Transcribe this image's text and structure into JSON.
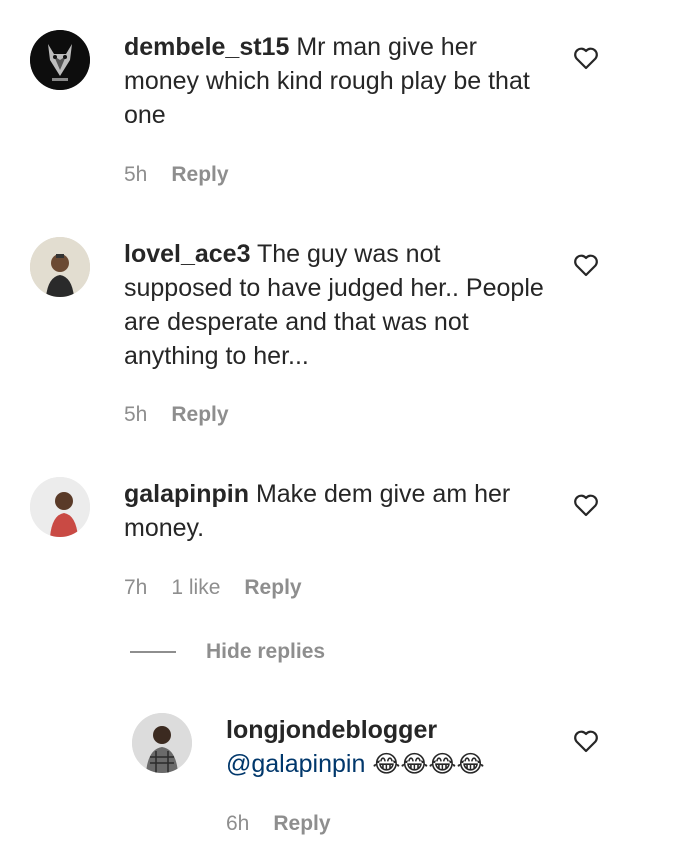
{
  "comments": [
    {
      "username": "dembele_st15",
      "text": " Mr man give her money which kind rough play be that one",
      "time": "5h",
      "reply_label": "Reply",
      "avatar": "wolf-avatar"
    },
    {
      "username": "lovel_ace3",
      "text": " The guy was not supposed to have judged her.. People are desperate and that was not anything to her...",
      "time": "5h",
      "reply_label": "Reply",
      "avatar": "person-avatar"
    },
    {
      "username": "galapinpin",
      "text": " Make dem give am her money.",
      "time": "7h",
      "likes": "1 like",
      "reply_label": "Reply",
      "avatar": "person-avatar"
    }
  ],
  "hide_replies_label": "Hide replies",
  "reply": {
    "username": "longjondeblogger",
    "mention": "@galapinpin",
    "emojis": "😂😂😂😂",
    "time": "6h",
    "reply_label": "Reply",
    "avatar": "person-avatar"
  },
  "icons": {
    "like": "heart-outline-icon"
  },
  "colors": {
    "text": "#262626",
    "secondary": "#8e8e8e",
    "mention": "#00376b"
  }
}
